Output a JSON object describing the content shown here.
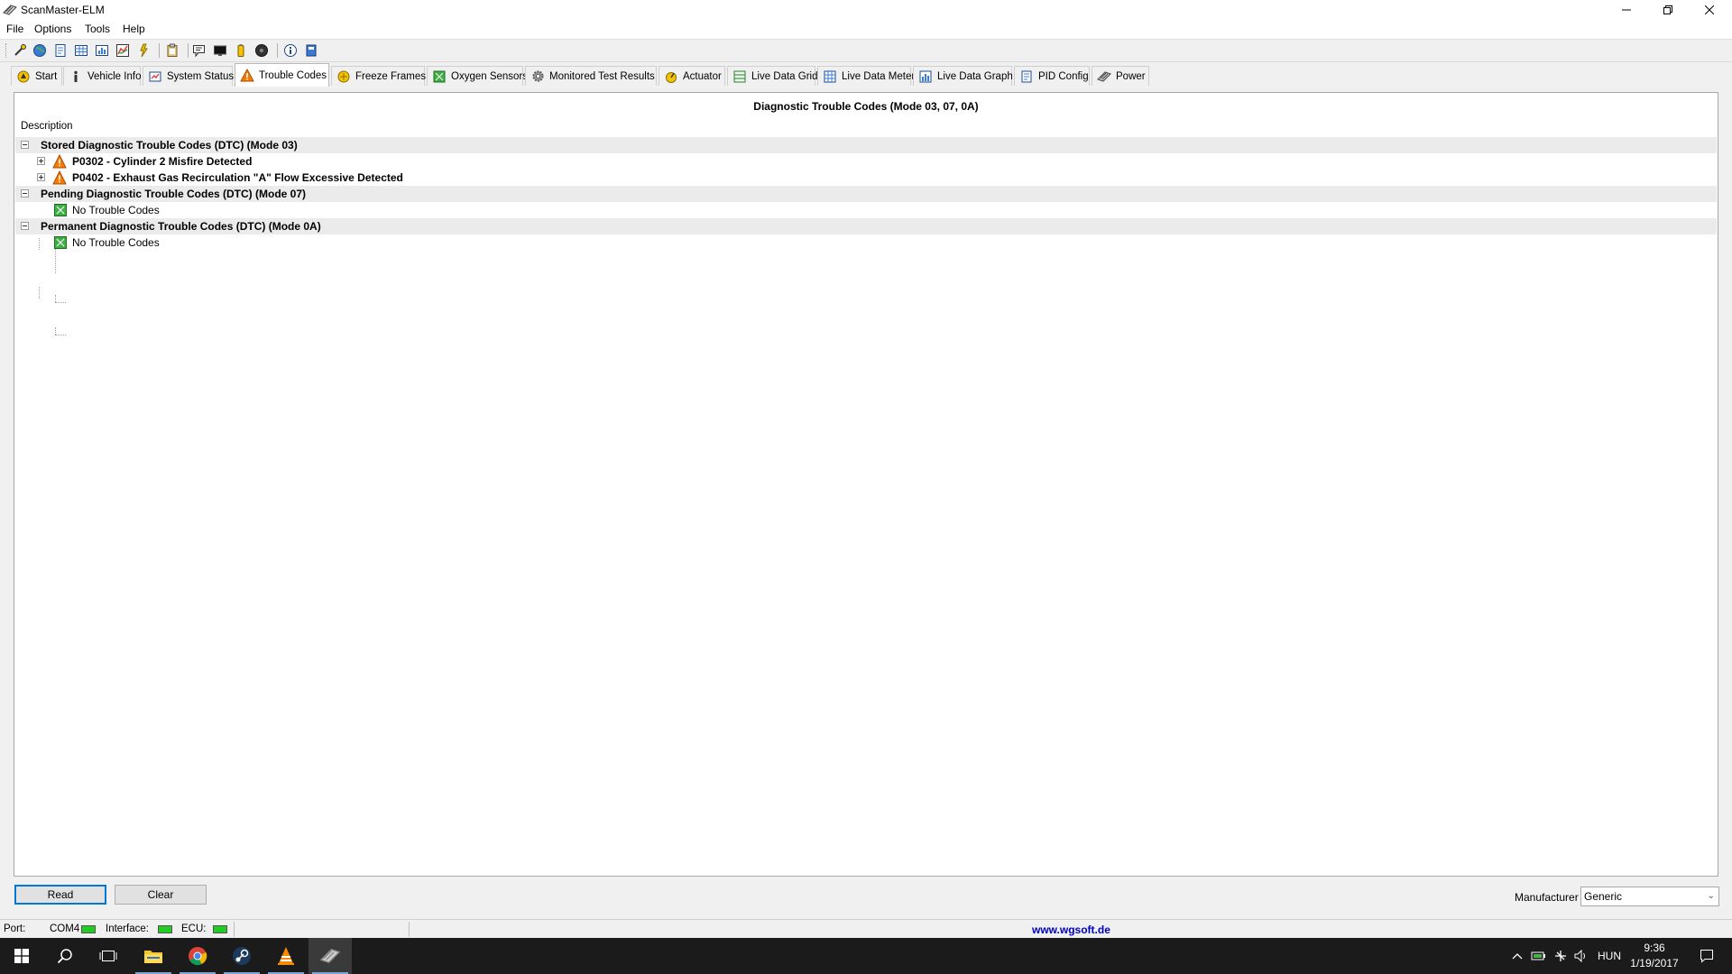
{
  "window": {
    "title": "ScanMaster-ELM"
  },
  "menu": [
    "File",
    "Options",
    "Tools",
    "Help"
  ],
  "toolbar_icons": [
    "connect-icon",
    "globe-icon",
    "report-icon",
    "grid-icon",
    "meter-icon",
    "graph-icon",
    "power-icon",
    "clipboard-icon",
    "terminal-chat-icon",
    "monitor-icon",
    "battery-icon",
    "disc-icon",
    "info-icon",
    "book-icon"
  ],
  "tabs": [
    {
      "label": "Start",
      "icon": "start-icon"
    },
    {
      "label": "Vehicle Info",
      "icon": "info-icon"
    },
    {
      "label": "System Status",
      "icon": "system-status-icon"
    },
    {
      "label": "Trouble Codes",
      "icon": "warning-icon",
      "active": true
    },
    {
      "label": "Freeze Frames",
      "icon": "freeze-frames-icon"
    },
    {
      "label": "Oxygen Sensors",
      "icon": "oxygen-sensor-icon"
    },
    {
      "label": "Monitored Test Results",
      "icon": "gear-icon"
    },
    {
      "label": "Actuator",
      "icon": "actuator-icon"
    },
    {
      "label": "Live Data Grid",
      "icon": "grid-icon"
    },
    {
      "label": "Live Data Meter",
      "icon": "meter-icon"
    },
    {
      "label": "Live Data Graph",
      "icon": "graph-icon"
    },
    {
      "label": "PID Config",
      "icon": "pid-config-icon"
    },
    {
      "label": "Power",
      "icon": "power-icon"
    }
  ],
  "dtc": {
    "header": "Diagnostic Trouble Codes (Mode 03, 07, 0A)",
    "column": "Description",
    "groups": [
      {
        "label": "Stored Diagnostic Trouble Codes (DTC) (Mode 03)",
        "items": [
          "P0302 - Cylinder 2 Misfire Detected",
          "P0402 - Exhaust Gas Recirculation \"A\" Flow Excessive Detected"
        ]
      },
      {
        "label": "Pending Diagnostic Trouble Codes (DTC) (Mode 07)",
        "items": [
          "No Trouble Codes"
        ]
      },
      {
        "label": "Permanent Diagnostic Trouble Codes (DTC) (Mode 0A)",
        "items": [
          "No Trouble Codes"
        ]
      }
    ]
  },
  "buttons": {
    "read": "Read",
    "clear": "Clear"
  },
  "manufacturer": {
    "label": "Manufacturer",
    "value": "Generic"
  },
  "status": {
    "port_label": "Port:",
    "port_value": "COM4",
    "interface_label": "Interface:",
    "ecu_label": "ECU:",
    "website": "www.wgsoft.de",
    "led_color": "#22cc22"
  },
  "taskbar": {
    "language": "HUN",
    "time": "9:36",
    "date": "1/19/2017"
  }
}
